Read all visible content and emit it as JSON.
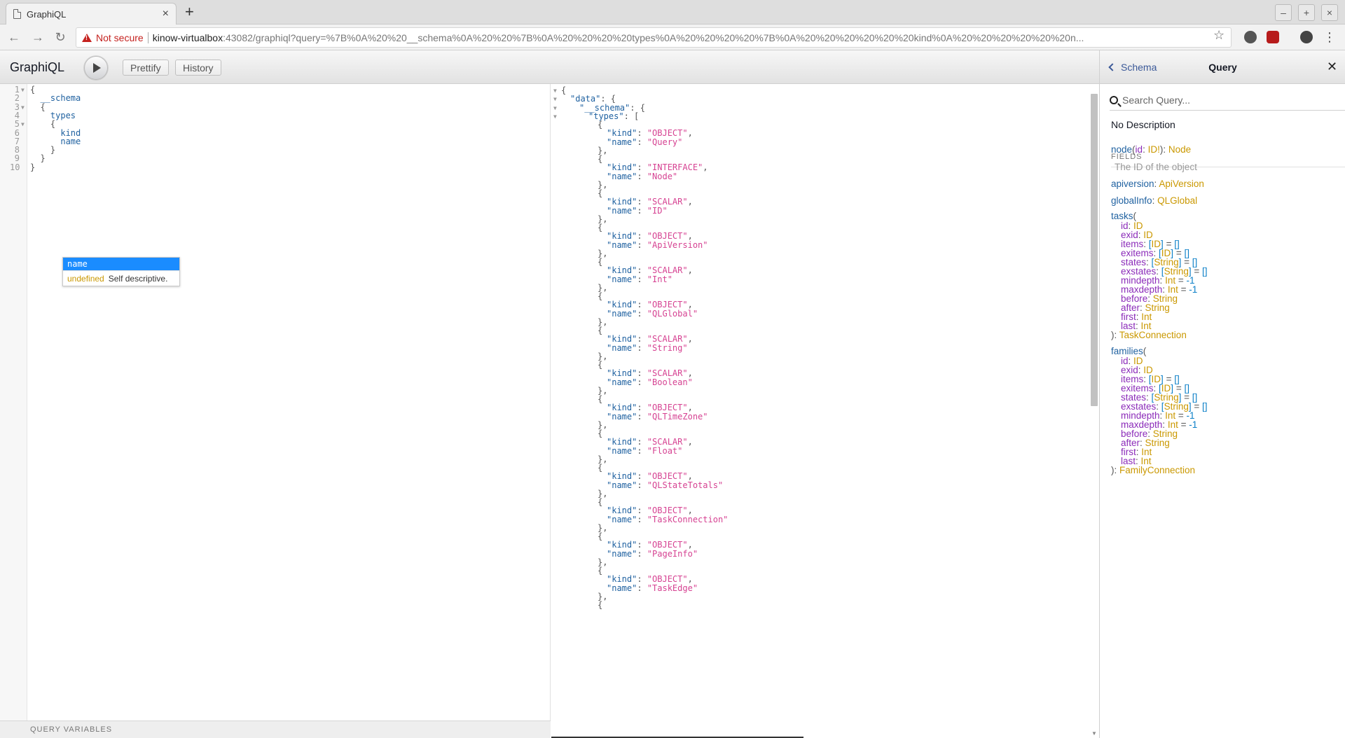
{
  "browser": {
    "tab_title": "GraphiQL",
    "tab_close": "×",
    "new_tab": "+",
    "security_label": "Not secure",
    "url_host": "kinow-virtualbox",
    "url_rest": ":43082/graphiql?query=%7B%0A%20%20__schema%0A%20%20%7B%0A%20%20%20%20types%0A%20%20%20%20%7B%0A%20%20%20%20%20%20kind%0A%20%20%20%20%20%20n..."
  },
  "toolbar": {
    "title": "GraphiQL",
    "prettify_label": "Prettify",
    "history_label": "History"
  },
  "editor": {
    "lines": [
      "{",
      "  __schema",
      "  {",
      "    types",
      "    {",
      "      kind",
      "      name",
      "    }",
      "  }",
      "}"
    ],
    "line_numbers": [
      "1",
      "2",
      "3",
      "4",
      "5",
      "6",
      "7",
      "8",
      "9",
      "10"
    ],
    "hint_active": "name",
    "hint_type": "undefined",
    "hint_desc": "Self descriptive.",
    "vars_label": "QUERY VARIABLES"
  },
  "result": {
    "types": [
      {
        "kind": "OBJECT",
        "name": "Query"
      },
      {
        "kind": "INTERFACE",
        "name": "Node"
      },
      {
        "kind": "SCALAR",
        "name": "ID"
      },
      {
        "kind": "OBJECT",
        "name": "ApiVersion"
      },
      {
        "kind": "SCALAR",
        "name": "Int"
      },
      {
        "kind": "OBJECT",
        "name": "QLGlobal"
      },
      {
        "kind": "SCALAR",
        "name": "String"
      },
      {
        "kind": "SCALAR",
        "name": "Boolean"
      },
      {
        "kind": "OBJECT",
        "name": "QLTimeZone"
      },
      {
        "kind": "SCALAR",
        "name": "Float"
      },
      {
        "kind": "OBJECT",
        "name": "QLStateTotals"
      },
      {
        "kind": "OBJECT",
        "name": "TaskConnection"
      },
      {
        "kind": "OBJECT",
        "name": "PageInfo"
      },
      {
        "kind": "OBJECT",
        "name": "TaskEdge"
      }
    ]
  },
  "docs": {
    "back_label": "Schema",
    "title": "Query",
    "close": "✕",
    "search_placeholder": "Search Query...",
    "description": "No Description",
    "fields_label": "FIELDS",
    "node_desc": "The ID of the object",
    "node_field": "node",
    "node_arg": "id",
    "node_arg_type": "ID!",
    "node_type": "Node",
    "apiversion_field": "apiversion",
    "apiversion_type": "ApiVersion",
    "globalinfo_field": "globalInfo",
    "globalinfo_type": "QLGlobal",
    "tasks_field": "tasks",
    "tasks_type": "TaskConnection",
    "families_field": "families",
    "families_type": "FamilyConnection",
    "args": [
      {
        "name": "id",
        "type": "ID",
        "list": false,
        "default": ""
      },
      {
        "name": "exid",
        "type": "ID",
        "list": false,
        "default": ""
      },
      {
        "name": "items",
        "type": "ID",
        "list": true,
        "default": "[]"
      },
      {
        "name": "exitems",
        "type": "ID",
        "list": true,
        "default": "[]"
      },
      {
        "name": "states",
        "type": "String",
        "list": true,
        "default": "[]"
      },
      {
        "name": "exstates",
        "type": "String",
        "list": true,
        "default": "[]"
      },
      {
        "name": "mindepth",
        "type": "Int",
        "list": false,
        "default": "-1"
      },
      {
        "name": "maxdepth",
        "type": "Int",
        "list": false,
        "default": "-1"
      },
      {
        "name": "before",
        "type": "String",
        "list": false,
        "default": ""
      },
      {
        "name": "after",
        "type": "String",
        "list": false,
        "default": ""
      },
      {
        "name": "first",
        "type": "Int",
        "list": false,
        "default": ""
      },
      {
        "name": "last",
        "type": "Int",
        "list": false,
        "default": ""
      }
    ]
  }
}
